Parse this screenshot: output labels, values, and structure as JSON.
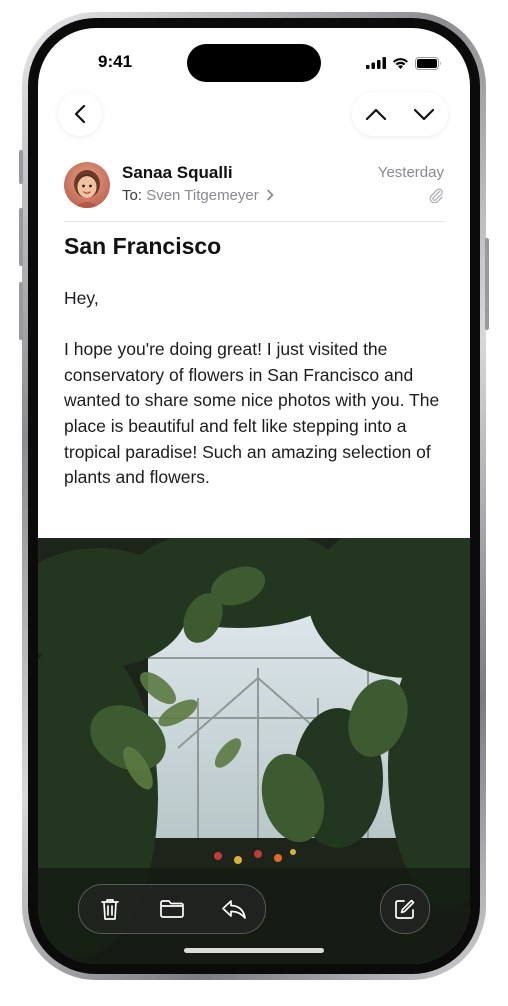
{
  "status_bar": {
    "time": "9:41"
  },
  "nav": {
    "back_icon": "chevron-left-icon",
    "prev_icon": "chevron-up-icon",
    "next_icon": "chevron-down-icon"
  },
  "message": {
    "sender": "Sanaa Squalli",
    "to_label": "To:",
    "recipient": "Sven Titgemeyer",
    "date": "Yesterday",
    "subject": "San Francisco",
    "greeting": "Hey,",
    "body": "I hope you're doing great! I just visited the conservatory of flowers in San Francisco and wanted to share some nice photos with you. The place is beautiful and felt like stepping into a tropical paradise! Such an amazing selection of plants and flowers."
  },
  "toolbar": {
    "trash_icon": "trash-icon",
    "folder_icon": "folder-icon",
    "reply_icon": "reply-icon",
    "compose_icon": "compose-icon"
  },
  "colors": {
    "text_primary": "#111111",
    "text_secondary": "#8a8a8e",
    "photo_foliage": "#2f4a2a"
  }
}
